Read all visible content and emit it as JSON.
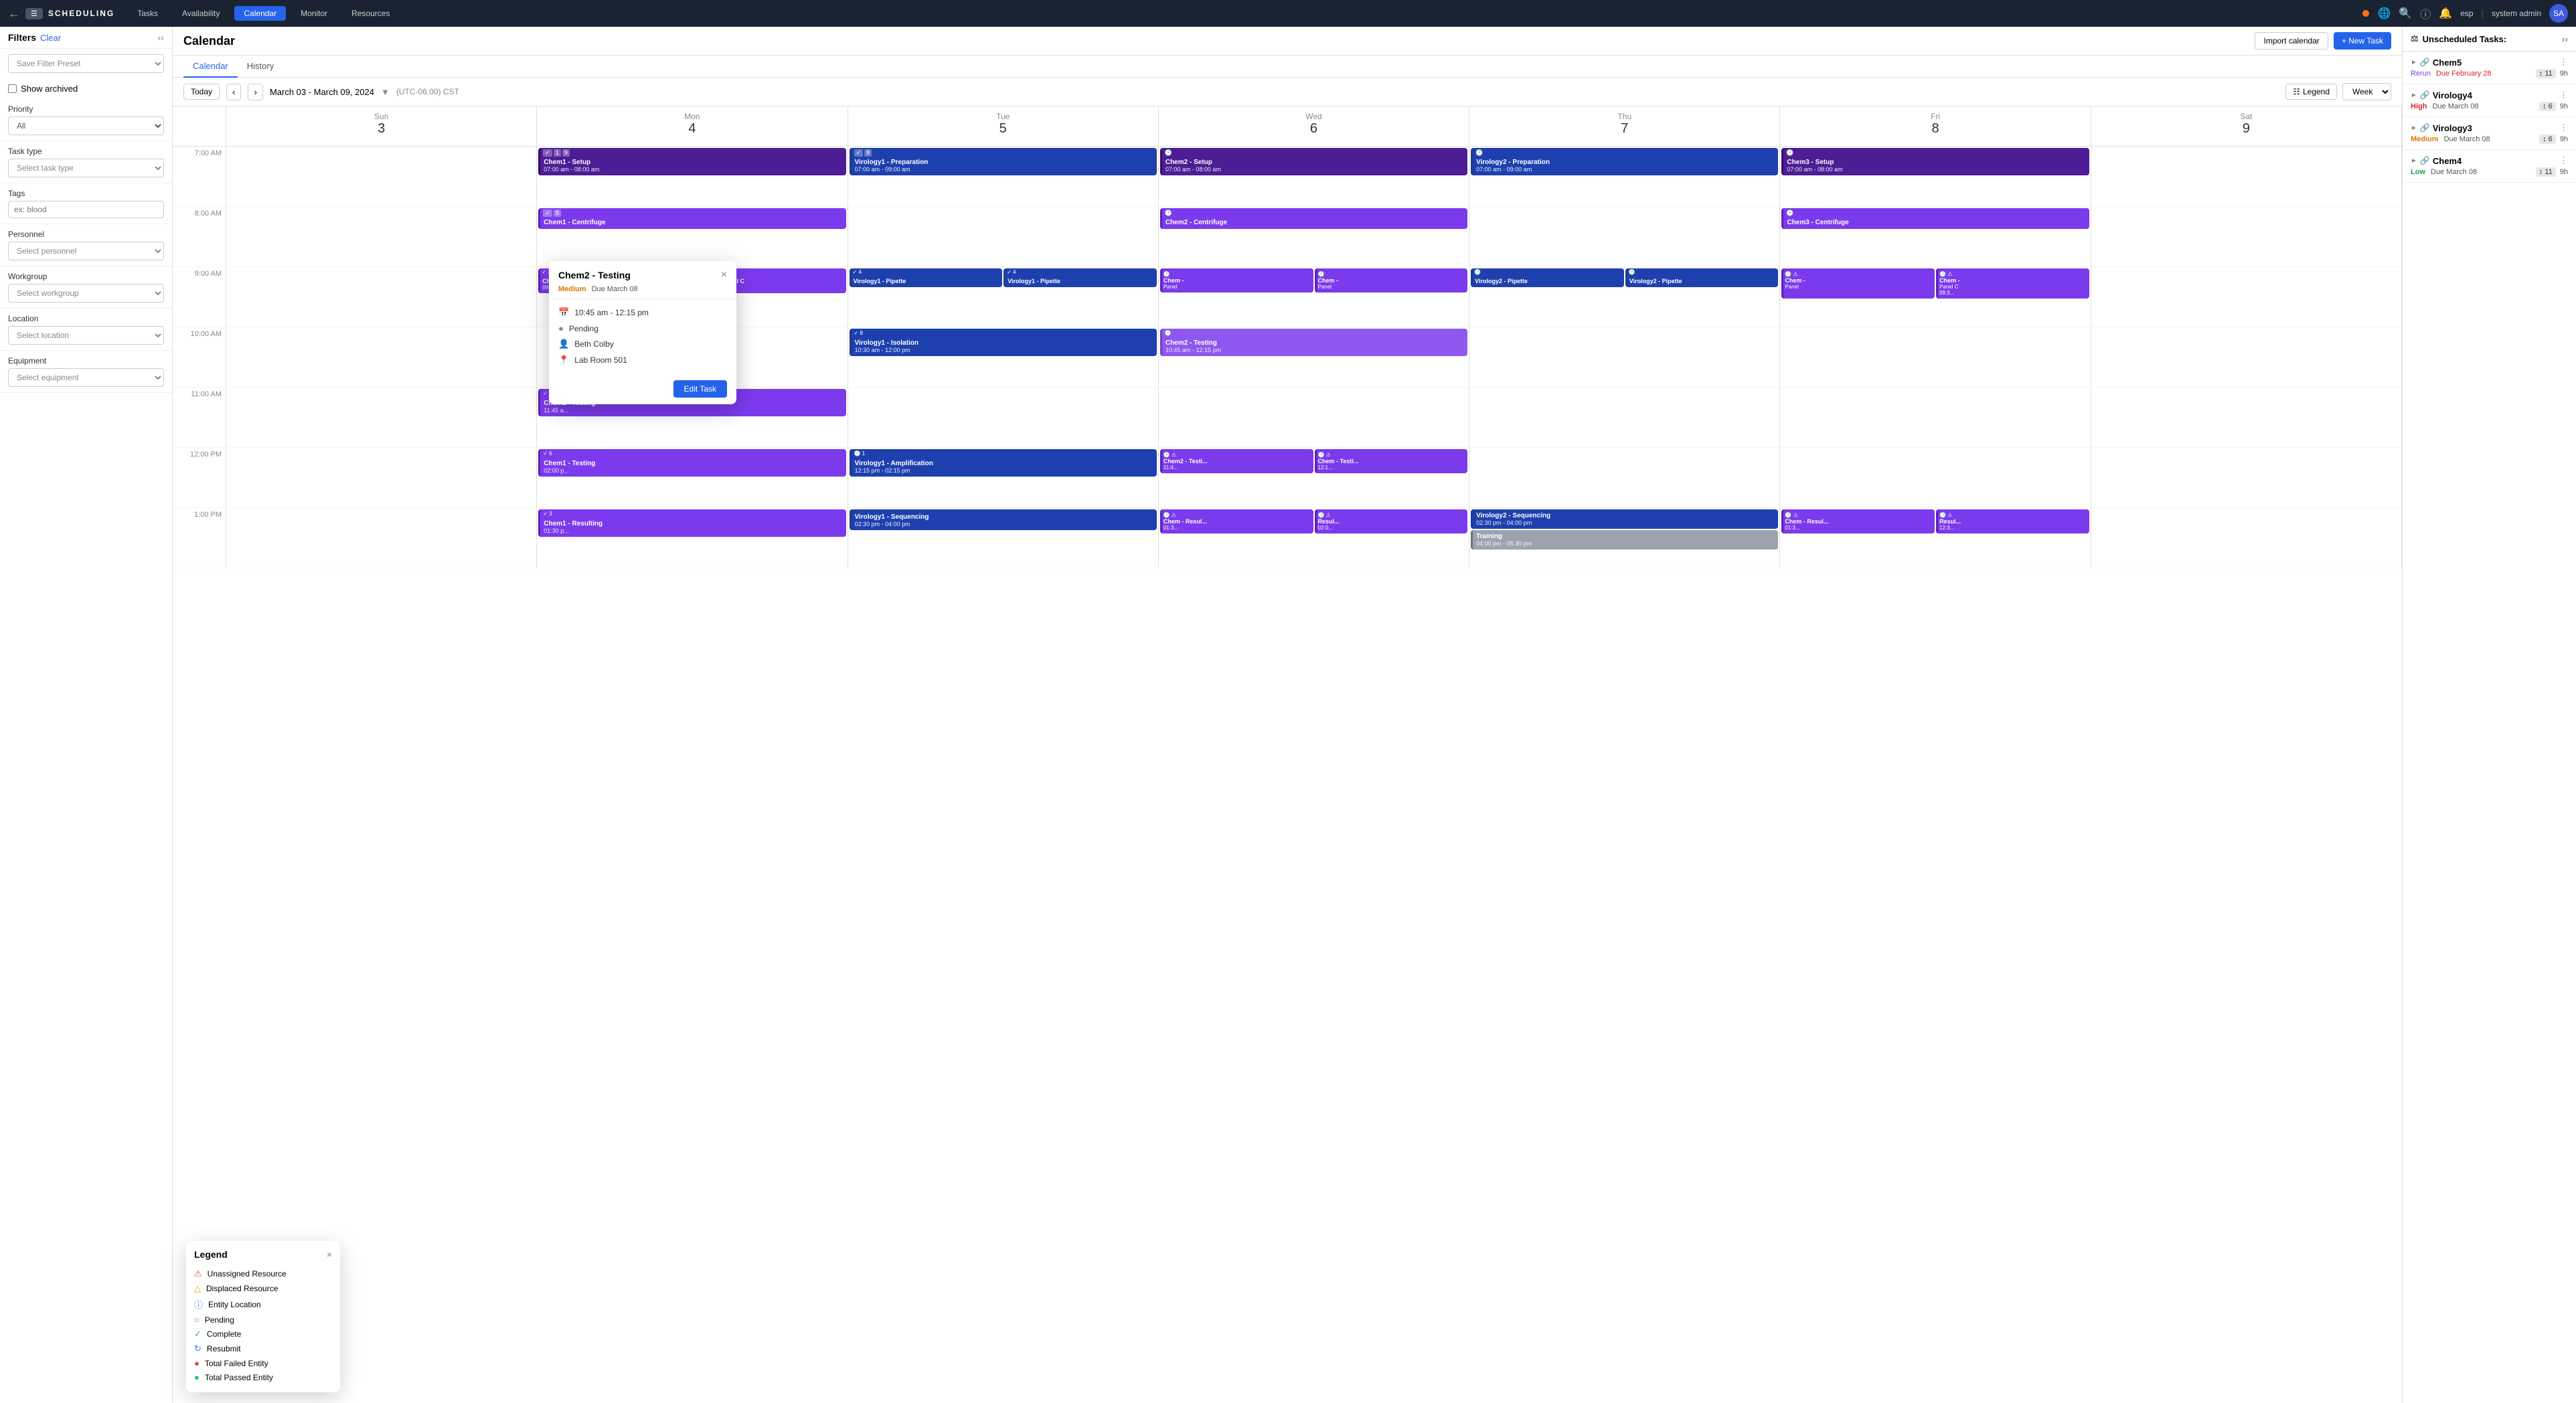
{
  "app": {
    "title": "SCHEDULING",
    "nav_items": [
      "Tasks",
      "Availability",
      "Calendar",
      "Monitor",
      "Resources"
    ],
    "active_nav": "Calendar",
    "user": "system admin",
    "lang": "esp"
  },
  "page": {
    "title": "Calendar",
    "import_btn": "Import calendar",
    "new_task_btn": "+ New Task"
  },
  "tabs": [
    {
      "label": "Calendar",
      "active": true
    },
    {
      "label": "History",
      "active": false
    }
  ],
  "toolbar": {
    "today": "Today",
    "date_range": "March 03 - March 09, 2024",
    "timezone": "(UTC-06:00) CST",
    "legend": "Legend",
    "view": "Week"
  },
  "filters": {
    "title": "Filters",
    "clear": "Clear",
    "preset_placeholder": "Save Filter Preset",
    "show_archived": "Show archived",
    "priority_label": "Priority",
    "priority_value": "All",
    "task_type_label": "Task type",
    "task_type_placeholder": "Select task type",
    "tags_label": "Tags",
    "tags_placeholder": "ex: blood",
    "personnel_label": "Personnel",
    "personnel_placeholder": "Select personnel",
    "workgroup_label": "Workgroup",
    "workgroup_placeholder": "Select workgroup",
    "location_label": "Location",
    "location_placeholder": "Select location",
    "equipment_label": "Equipment",
    "equipment_placeholder": "Select equipment"
  },
  "days": [
    {
      "name": "Sun",
      "num": "3"
    },
    {
      "name": "Mon",
      "num": "4"
    },
    {
      "name": "Tue",
      "num": "5"
    },
    {
      "name": "Wed",
      "num": "6"
    },
    {
      "name": "Thu",
      "num": "7"
    },
    {
      "name": "Fri",
      "num": "8"
    },
    {
      "name": "Sat",
      "num": "9"
    }
  ],
  "time_slots": [
    "7:00 AM",
    "8:00 AM",
    "9:00 AM",
    "10:00 AM",
    "11:00 AM",
    "12:00 PM",
    "1:00 PM"
  ],
  "popup": {
    "title": "Chem2 - Testing",
    "priority": "Medium",
    "due": "Due March 08",
    "time": "10:45 am - 12:15 pm",
    "status": "Pending",
    "person": "Beth Colby",
    "location": "Lab Room 501",
    "edit_btn": "Edit Task"
  },
  "legend": {
    "title": "Legend",
    "items": [
      {
        "icon": "⚠",
        "color": "#ef4444",
        "label": "Unassigned Resource"
      },
      {
        "icon": "⚠",
        "color": "#f59e0b",
        "label": "Displaced Resource"
      },
      {
        "icon": "ℹ",
        "color": "#3b82f6",
        "label": "Entity Location"
      },
      {
        "icon": "○",
        "color": "#6b7280",
        "label": "Pending"
      },
      {
        "icon": "✓",
        "color": "#22c55e",
        "label": "Complete"
      },
      {
        "icon": "↻",
        "color": "#3b82f6",
        "label": "Resubmit"
      },
      {
        "icon": "●",
        "color": "#ef4444",
        "label": "Total Failed Entity"
      },
      {
        "icon": "●",
        "color": "#22c55e",
        "label": "Total Passed Entity"
      }
    ]
  },
  "unscheduled": {
    "title": "Unscheduled Tasks:",
    "items": [
      {
        "title": "Chem5",
        "status": "Rerun",
        "due_label": "Due February 28",
        "due_overdue": true,
        "count": 11,
        "hours": "9h"
      },
      {
        "title": "Virology4",
        "priority": "High",
        "due_label": "Due March 08",
        "due_overdue": false,
        "count": 6,
        "hours": "9h"
      },
      {
        "title": "Virology3",
        "priority": "Medium",
        "due_label": "Due March 08",
        "due_overdue": false,
        "count": 6,
        "hours": "9h"
      },
      {
        "title": "Chem4",
        "priority": "Low",
        "due_label": "Due March 08",
        "due_overdue": false,
        "count": 11,
        "hours": "9h"
      }
    ]
  }
}
